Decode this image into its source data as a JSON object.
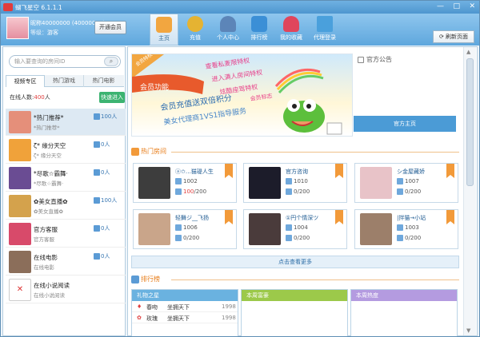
{
  "window": {
    "title": "蝴飞星空 6.1.1.1",
    "min": "—",
    "max": "□",
    "close": "✕"
  },
  "user": {
    "id_line": "昵称40000000 (40000000)",
    "level_label": "等级：",
    "level_value": "游客",
    "vip_button": "开通会员"
  },
  "nav": [
    {
      "label": "主页",
      "icon": "home-icon",
      "color": "#f2a640"
    },
    {
      "label": "充值",
      "icon": "coins-icon",
      "color": "#e5b332"
    },
    {
      "label": "个人中心",
      "icon": "person-icon",
      "color": "#5c85b8"
    },
    {
      "label": "排行榜",
      "icon": "ranking-icon",
      "color": "#3b8fd6"
    },
    {
      "label": "我的收藏",
      "icon": "heart-icon",
      "color": "#e0455c"
    },
    {
      "label": "代理登录",
      "icon": "monitor-icon",
      "color": "#4aa0dc"
    }
  ],
  "refresh_button": "刷新页面",
  "left": {
    "search_placeholder": "输入要查询的房间ID",
    "search_icon": "search-icon",
    "tabs": [
      "视频专区",
      "热门游戏",
      "热门电影"
    ],
    "online_label": "在线人数:",
    "online_count": "400",
    "online_unit": "人",
    "quick_enter": "快速进入",
    "rooms": [
      {
        "name": "*热门推荐*",
        "sub": "*热门推荐*",
        "count": "100人",
        "color": "#e58f7a"
      },
      {
        "name": "ζ* 缘分天空",
        "sub": "ζ* 缘分天空",
        "count": "0人",
        "color": "#f0a23a"
      },
      {
        "name": "*尽歌☆霸舞·",
        "sub": "*尽歌☆霸舞·",
        "count": "0人",
        "color": "#6a4c93"
      },
      {
        "name": "✿美女直播✿",
        "sub": "✿美女直播✿",
        "count": "100人",
        "color": "#d4a24c"
      },
      {
        "name": "官方客服",
        "sub": "官方客服",
        "count": "0人",
        "color": "#d84a6a"
      },
      {
        "name": "在线电影",
        "sub": "在线电影",
        "count": "0人",
        "color": "#8b6e5a"
      },
      {
        "name": "在线小说阅读",
        "sub": "在线小说阅读",
        "count": "",
        "color": "#ffffff"
      }
    ]
  },
  "main": {
    "banner": {
      "tag": "会员特权",
      "lines": [
        "查看私麦限特权",
        "进入满人房间特权",
        "炫酷座驾特权",
        "会员标志"
      ],
      "feature": "会员功能",
      "double": "会员充值送双倍积分",
      "footer": "美女代理商1VS1指导服务"
    },
    "notice_title": "官方公告",
    "official_home": "官方主页",
    "hot_title": "热门房间",
    "hot_rooms": [
      {
        "name": "ⓐ✩…猫瑅人生",
        "id": "1002",
        "users": "100",
        "max": "/200",
        "color": "#3d3d3d"
      },
      {
        "name": "官方咨询",
        "id": "1010",
        "users": "0",
        "max": "/200",
        "color": "#1c1c2a"
      },
      {
        "name": "シ金屋藏娇",
        "id": "1007",
        "users": "0",
        "max": "/200",
        "color": "#e8c3c8"
      },
      {
        "name": "轻舞ジ__飞扬",
        "id": "1006",
        "users": "0",
        "max": "/200",
        "color": "#c9a58a"
      },
      {
        "name": "①円个情深ツ",
        "id": "1004",
        "users": "0",
        "max": "/200",
        "color": "#4a3b3b"
      },
      {
        "name": "|拌猫→小站",
        "id": "1003",
        "users": "0",
        "max": "/200",
        "color": "#9c7f6a"
      }
    ],
    "more_label": "点击查看更多",
    "rank_title": "排行榜",
    "rank_boards": [
      {
        "title": "礼物之星",
        "color": "#6ab2e0",
        "rows": [
          {
            "gift": "春吻",
            "user": "坐拥天下",
            "score": "1998"
          },
          {
            "gift": "玫瑰",
            "user": "坐拥天下",
            "score": "1998"
          }
        ]
      },
      {
        "title": "本周富豪",
        "color": "#9cc94a",
        "rows": []
      },
      {
        "title": "本周热度",
        "color": "#b49be0",
        "rows": []
      }
    ]
  }
}
